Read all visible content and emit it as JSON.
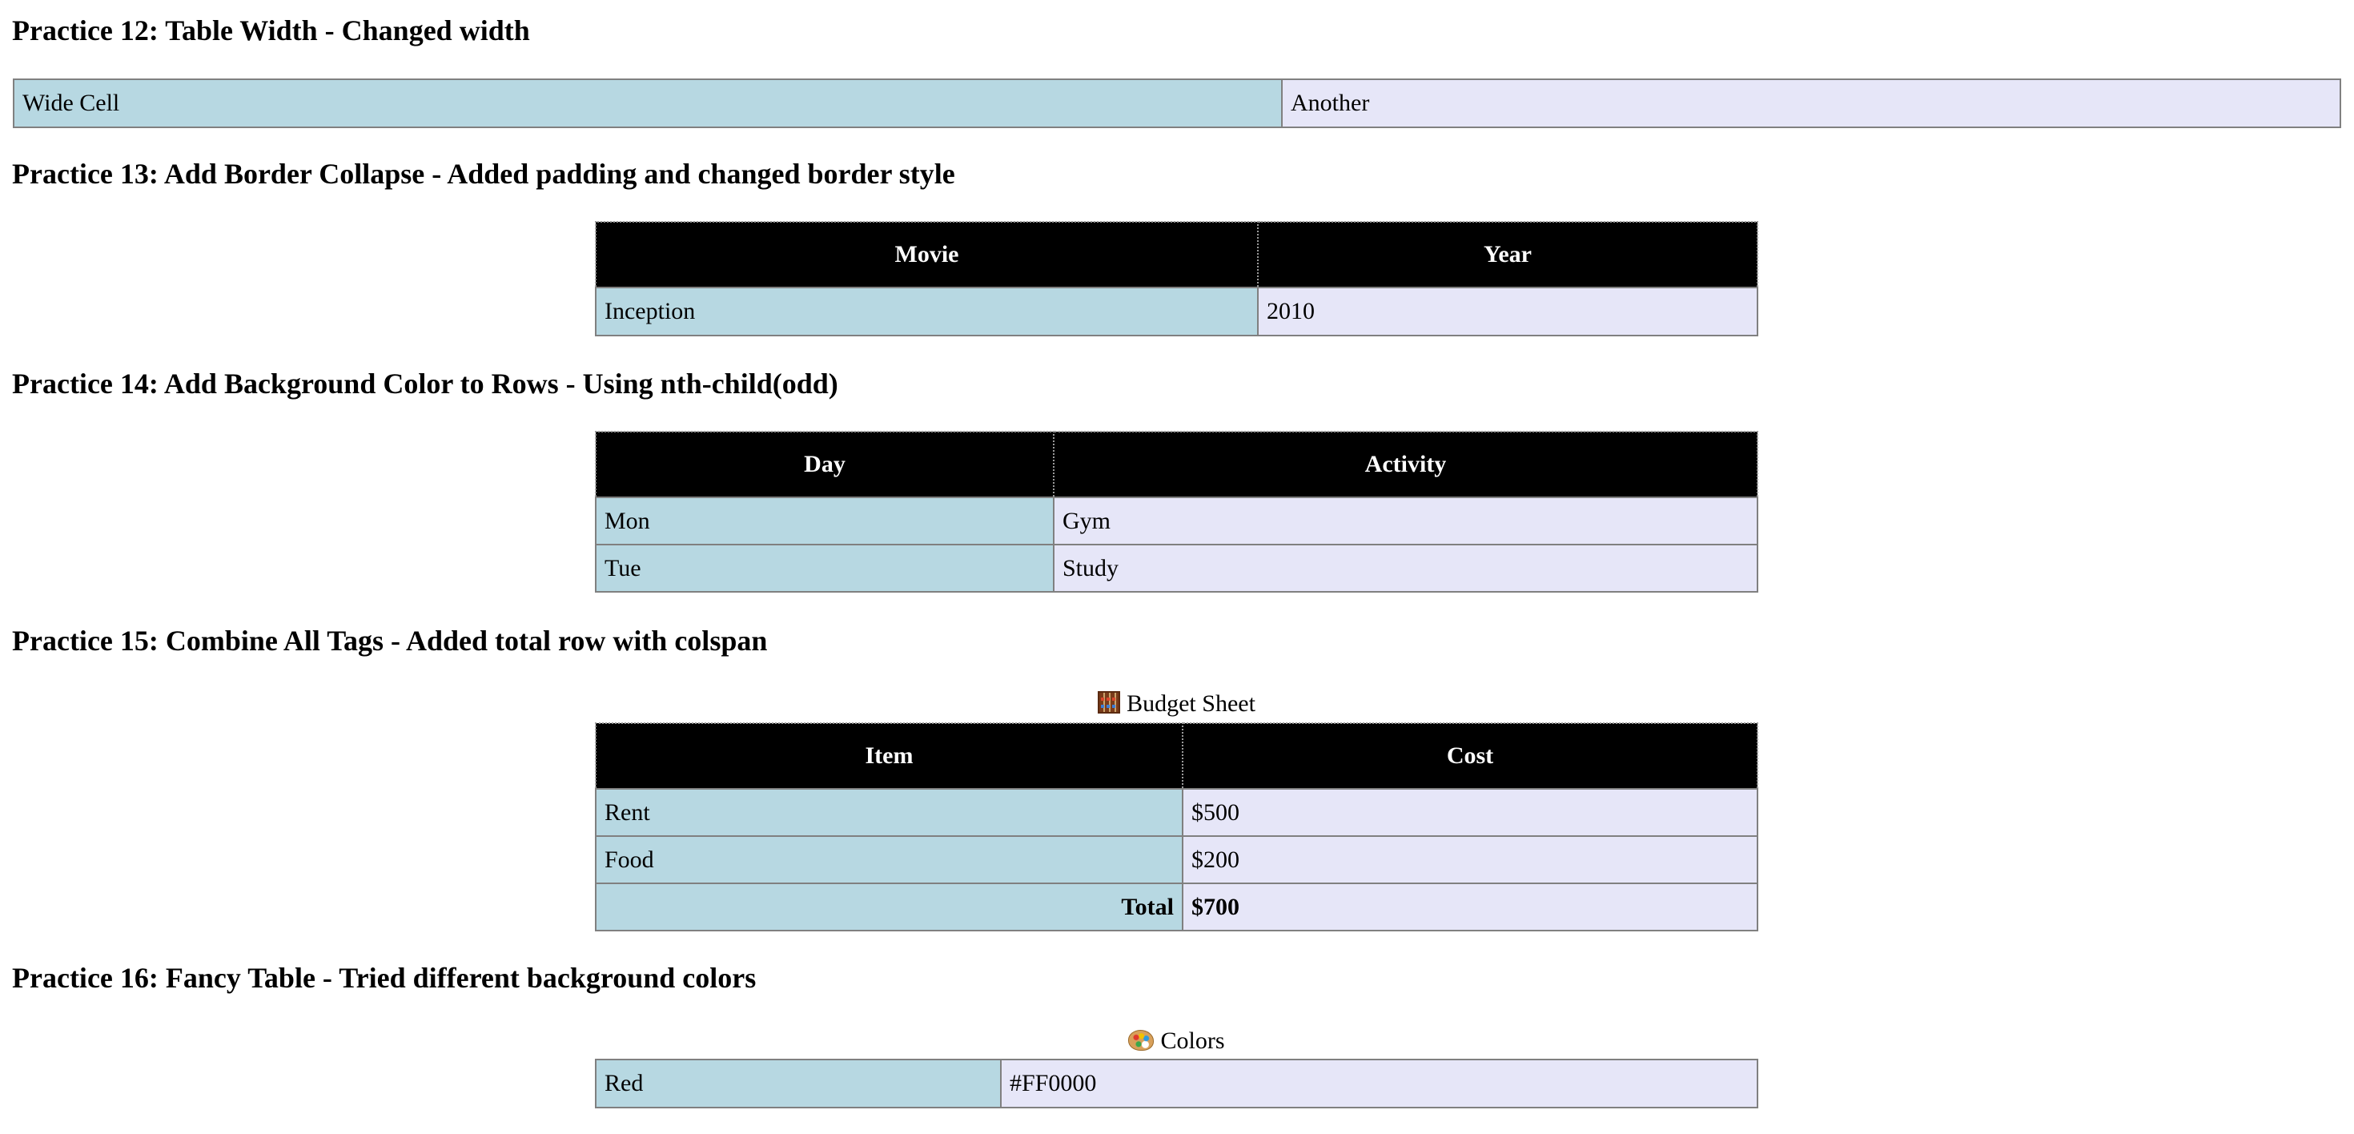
{
  "p12": {
    "title": "Practice 12: Table Width - Changed width",
    "cells": [
      "Wide Cell",
      "Another"
    ]
  },
  "p13": {
    "title": "Practice 13: Add Border Collapse - Added padding and changed border style",
    "headers": [
      "Movie",
      "Year"
    ],
    "rows": [
      [
        "Inception",
        "2010"
      ]
    ]
  },
  "p14": {
    "title": "Practice 14: Add Background Color to Rows - Using nth-child(odd)",
    "headers": [
      "Day",
      "Activity"
    ],
    "rows": [
      [
        "Mon",
        "Gym"
      ],
      [
        "Tue",
        "Study"
      ]
    ]
  },
  "p15": {
    "title": "Practice 15: Combine All Tags - Added total row with colspan",
    "caption": "Budget Sheet",
    "caption_icon": "abacus-icon",
    "headers": [
      "Item",
      "Cost"
    ],
    "rows": [
      [
        "Rent",
        "$500"
      ],
      [
        "Food",
        "$200"
      ]
    ],
    "total_label": "Total",
    "total_value": "$700"
  },
  "p16": {
    "title": "Practice 16: Fancy Table - Tried different background colors",
    "caption": "Colors",
    "caption_icon": "palette-icon",
    "rows": [
      [
        "Red",
        "#FF0000"
      ]
    ]
  },
  "colors": {
    "header_bg": "#000000",
    "header_text": "#ffffff",
    "first_column_bg": "#b7d8e2",
    "second_column_bg": "#e6e6f8",
    "border": "#808080"
  }
}
